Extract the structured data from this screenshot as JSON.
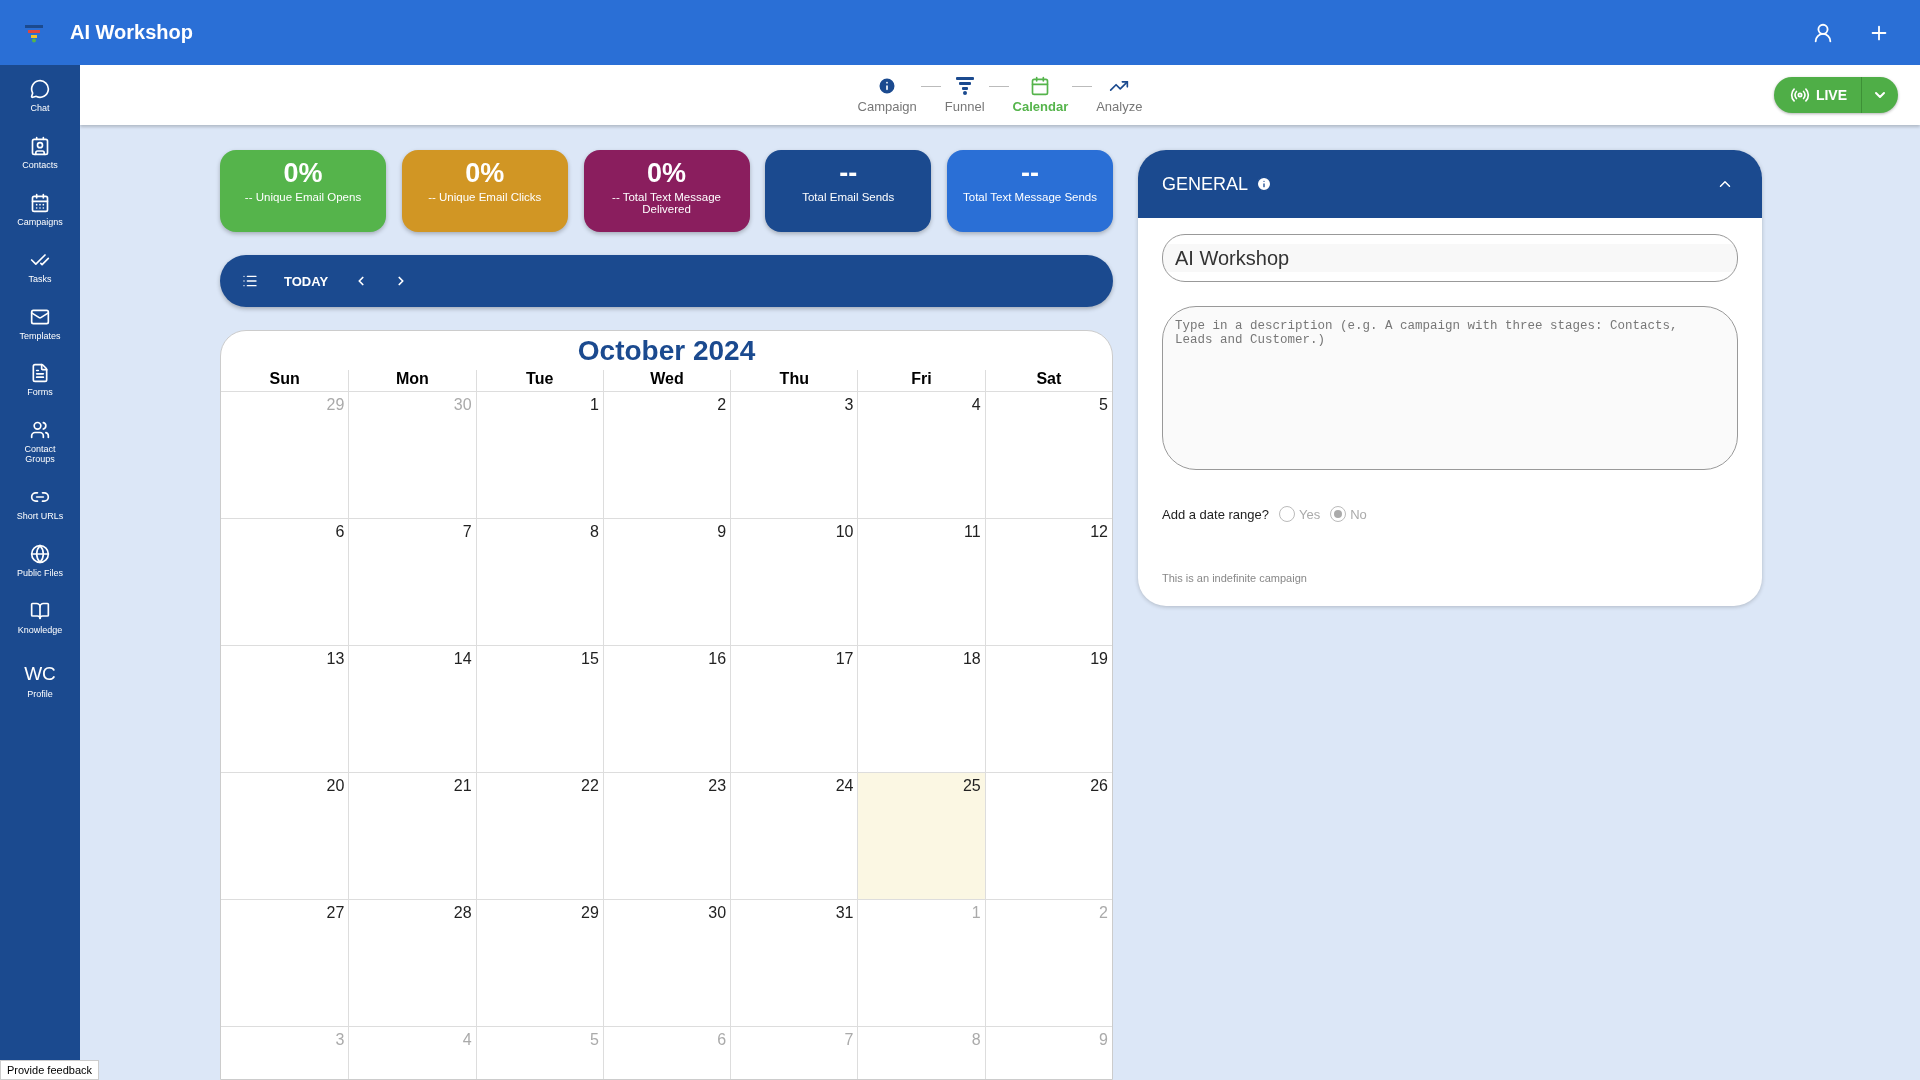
{
  "app_bar": {
    "title": "AI Workshop"
  },
  "sidebar": {
    "items": [
      {
        "label": "Chat",
        "kind": "chat"
      },
      {
        "label": "Contacts",
        "kind": "contacts"
      },
      {
        "label": "Campaigns",
        "kind": "campaigns"
      },
      {
        "label": "Tasks",
        "kind": "tasks"
      },
      {
        "label": "Templates",
        "kind": "templates"
      },
      {
        "label": "Forms",
        "kind": "forms"
      },
      {
        "label": "Contact Groups",
        "kind": "groups"
      },
      {
        "label": "Short URLs",
        "kind": "link"
      },
      {
        "label": "Public Files",
        "kind": "globe"
      },
      {
        "label": "Knowledge",
        "kind": "book"
      },
      {
        "label": "Profile",
        "kind": "avatar",
        "initials": "WC"
      }
    ]
  },
  "steps": [
    {
      "label": "Campaign",
      "kind": "info",
      "selected": false
    },
    {
      "label": "Funnel",
      "kind": "funnel",
      "selected": false
    },
    {
      "label": "Calendar",
      "kind": "calendar",
      "selected": true
    },
    {
      "label": "Analyze",
      "kind": "trend",
      "selected": false
    }
  ],
  "live_button": {
    "label": "LIVE"
  },
  "stats": [
    {
      "value": "0%",
      "label": "-- Unique Email Opens",
      "color": "#55b44b"
    },
    {
      "value": "0%",
      "label": "-- Unique Email Clicks",
      "color": "#d19624"
    },
    {
      "value": "0%",
      "label": "-- Total Text Message Delivered",
      "color": "#8a1e5e"
    },
    {
      "value": "--",
      "label": "Total Email Sends",
      "color": "#1b4a8f"
    },
    {
      "value": "--",
      "label": "Total Text Message Sends",
      "color": "#2a6fd6"
    }
  ],
  "calendar": {
    "today_button": "TODAY",
    "title": "October 2024",
    "weekdays": [
      "Sun",
      "Mon",
      "Tue",
      "Wed",
      "Thu",
      "Fri",
      "Sat"
    ],
    "weeks": [
      [
        {
          "day": "29",
          "outside": true,
          "today": false
        },
        {
          "day": "30",
          "outside": true,
          "today": false
        },
        {
          "day": "1",
          "outside": false,
          "today": false
        },
        {
          "day": "2",
          "outside": false,
          "today": false
        },
        {
          "day": "3",
          "outside": false,
          "today": false
        },
        {
          "day": "4",
          "outside": false,
          "today": false
        },
        {
          "day": "5",
          "outside": false,
          "today": false
        }
      ],
      [
        {
          "day": "6",
          "outside": false,
          "today": false
        },
        {
          "day": "7",
          "outside": false,
          "today": false
        },
        {
          "day": "8",
          "outside": false,
          "today": false
        },
        {
          "day": "9",
          "outside": false,
          "today": false
        },
        {
          "day": "10",
          "outside": false,
          "today": false
        },
        {
          "day": "11",
          "outside": false,
          "today": false
        },
        {
          "day": "12",
          "outside": false,
          "today": false
        }
      ],
      [
        {
          "day": "13",
          "outside": false,
          "today": false
        },
        {
          "day": "14",
          "outside": false,
          "today": false
        },
        {
          "day": "15",
          "outside": false,
          "today": false
        },
        {
          "day": "16",
          "outside": false,
          "today": false
        },
        {
          "day": "17",
          "outside": false,
          "today": false
        },
        {
          "day": "18",
          "outside": false,
          "today": false
        },
        {
          "day": "19",
          "outside": false,
          "today": false
        }
      ],
      [
        {
          "day": "20",
          "outside": false,
          "today": false
        },
        {
          "day": "21",
          "outside": false,
          "today": false
        },
        {
          "day": "22",
          "outside": false,
          "today": false
        },
        {
          "day": "23",
          "outside": false,
          "today": false
        },
        {
          "day": "24",
          "outside": false,
          "today": false
        },
        {
          "day": "25",
          "outside": false,
          "today": true
        },
        {
          "day": "26",
          "outside": false,
          "today": false
        }
      ],
      [
        {
          "day": "27",
          "outside": false,
          "today": false
        },
        {
          "day": "28",
          "outside": false,
          "today": false
        },
        {
          "day": "29",
          "outside": false,
          "today": false
        },
        {
          "day": "30",
          "outside": false,
          "today": false
        },
        {
          "day": "31",
          "outside": false,
          "today": false
        },
        {
          "day": "1",
          "outside": true,
          "today": false
        },
        {
          "day": "2",
          "outside": true,
          "today": false
        }
      ],
      [
        {
          "day": "3",
          "outside": true,
          "today": false
        },
        {
          "day": "4",
          "outside": true,
          "today": false
        },
        {
          "day": "5",
          "outside": true,
          "today": false
        },
        {
          "day": "6",
          "outside": true,
          "today": false
        },
        {
          "day": "7",
          "outside": true,
          "today": false
        },
        {
          "day": "8",
          "outside": true,
          "today": false
        },
        {
          "day": "9",
          "outside": true,
          "today": false
        }
      ]
    ]
  },
  "general": {
    "title": "GENERAL",
    "expanded": true,
    "name_value": "AI Workshop",
    "description_placeholder": "Type in a description (e.g. A campaign with three stages: Contacts, Leads and Customer.)",
    "date_range_label": "Add a date range?",
    "date_range_options": [
      {
        "label": "Yes",
        "selected": false,
        "disabled": true
      },
      {
        "label": "No",
        "selected": true,
        "disabled": true
      }
    ],
    "note": "This is an indefinite campaign"
  },
  "feedback_button": "Provide feedback"
}
